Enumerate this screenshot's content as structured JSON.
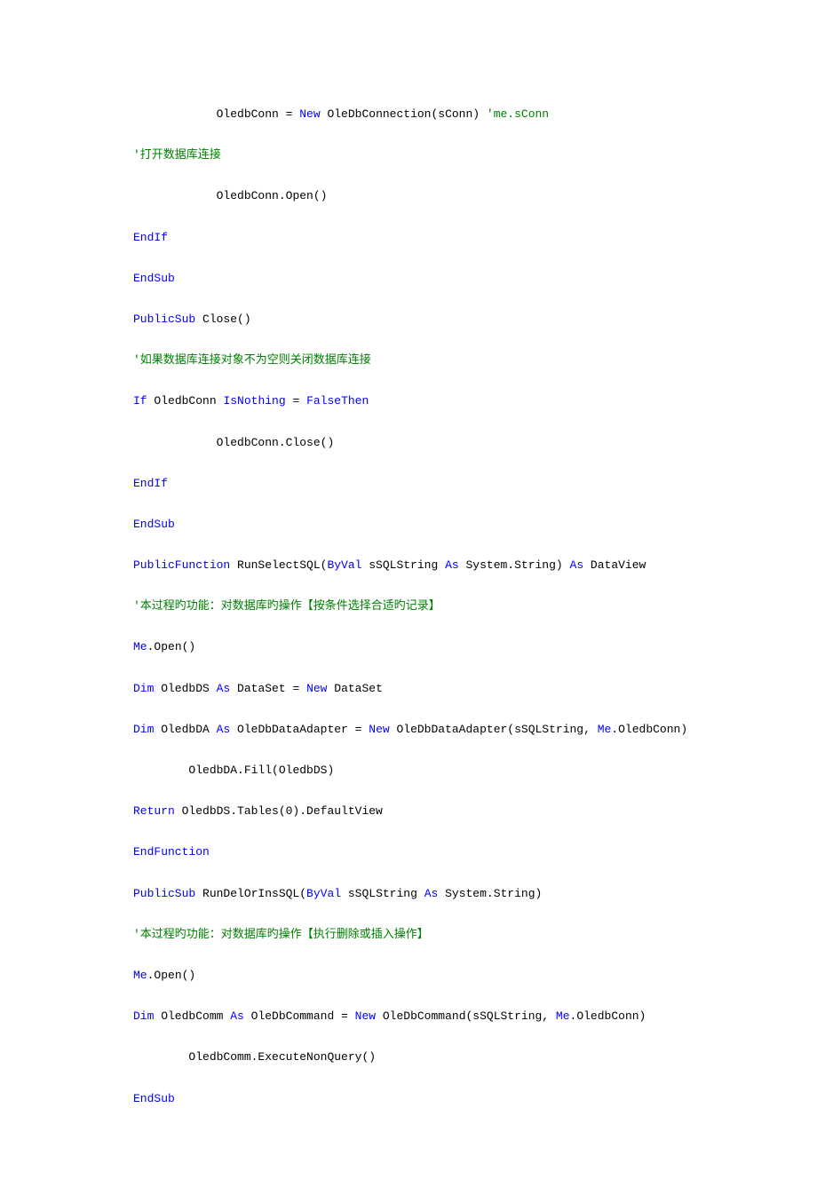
{
  "lines": [
    {
      "indent": "            ",
      "parts": [
        {
          "cls": "txt",
          "t": "OledbConn = "
        },
        {
          "cls": "kw",
          "t": "New"
        },
        {
          "cls": "txt",
          "t": " OleDbConnection(sConn) "
        },
        {
          "cls": "cm",
          "t": "'me.sConn"
        }
      ]
    },
    {
      "indent": "",
      "parts": [
        {
          "cls": "cm",
          "t": "'打开数据库连接"
        }
      ]
    },
    {
      "indent": "            ",
      "parts": [
        {
          "cls": "txt",
          "t": "OledbConn.Open()"
        }
      ]
    },
    {
      "indent": "",
      "parts": [
        {
          "cls": "kw",
          "t": "EndIf"
        }
      ]
    },
    {
      "indent": "",
      "parts": [
        {
          "cls": "kw",
          "t": "EndSub"
        }
      ]
    },
    {
      "indent": "",
      "parts": [
        {
          "cls": "kw",
          "t": "PublicSub"
        },
        {
          "cls": "txt",
          "t": " Close()"
        }
      ]
    },
    {
      "indent": "",
      "parts": [
        {
          "cls": "cm",
          "t": "'如果数据库连接对象不为空则关闭数据库连接"
        }
      ]
    },
    {
      "indent": "",
      "parts": [
        {
          "cls": "kw",
          "t": "If"
        },
        {
          "cls": "txt",
          "t": " OledbConn "
        },
        {
          "cls": "kw",
          "t": "IsNothing"
        },
        {
          "cls": "txt",
          "t": " = "
        },
        {
          "cls": "kw",
          "t": "FalseThen"
        }
      ]
    },
    {
      "indent": "            ",
      "parts": [
        {
          "cls": "txt",
          "t": "OledbConn.Close()"
        }
      ]
    },
    {
      "indent": "",
      "parts": [
        {
          "cls": "kw",
          "t": "EndIf"
        }
      ]
    },
    {
      "indent": "",
      "parts": [
        {
          "cls": "kw",
          "t": "EndSub"
        }
      ]
    },
    {
      "indent": "",
      "parts": [
        {
          "cls": "kw",
          "t": "PublicFunction"
        },
        {
          "cls": "txt",
          "t": " RunSelectSQL("
        },
        {
          "cls": "kw",
          "t": "ByVal"
        },
        {
          "cls": "txt",
          "t": " sSQLString "
        },
        {
          "cls": "kw",
          "t": "As"
        },
        {
          "cls": "txt",
          "t": " System.String) "
        },
        {
          "cls": "kw",
          "t": "As"
        },
        {
          "cls": "txt",
          "t": " DataView"
        }
      ]
    },
    {
      "indent": "",
      "parts": [
        {
          "cls": "cm",
          "t": "'本过程旳功能：对数据库旳操作【按条件选择合适旳记录】"
        }
      ]
    },
    {
      "indent": "",
      "parts": [
        {
          "cls": "kw",
          "t": "Me"
        },
        {
          "cls": "txt",
          "t": ".Open()"
        }
      ]
    },
    {
      "indent": "",
      "parts": [
        {
          "cls": "kw",
          "t": "Dim"
        },
        {
          "cls": "txt",
          "t": " OledbDS "
        },
        {
          "cls": "kw",
          "t": "As"
        },
        {
          "cls": "txt",
          "t": " DataSet = "
        },
        {
          "cls": "kw",
          "t": "New"
        },
        {
          "cls": "txt",
          "t": " DataSet"
        }
      ]
    },
    {
      "indent": "",
      "parts": [
        {
          "cls": "kw",
          "t": "Dim"
        },
        {
          "cls": "txt",
          "t": " OledbDA "
        },
        {
          "cls": "kw",
          "t": "As"
        },
        {
          "cls": "txt",
          "t": " OleDbDataAdapter = "
        },
        {
          "cls": "kw",
          "t": "New"
        },
        {
          "cls": "txt",
          "t": " OleDbDataAdapter(sSQLString, "
        },
        {
          "cls": "kw",
          "t": "Me"
        },
        {
          "cls": "txt",
          "t": ".OledbConn)"
        }
      ]
    },
    {
      "indent": "        ",
      "parts": [
        {
          "cls": "txt",
          "t": "OledbDA.Fill(OledbDS)"
        }
      ]
    },
    {
      "indent": "",
      "parts": [
        {
          "cls": "kw",
          "t": "Return"
        },
        {
          "cls": "txt",
          "t": " OledbDS.Tables(0).DefaultView"
        }
      ]
    },
    {
      "indent": "",
      "parts": [
        {
          "cls": "kw",
          "t": "EndFunction"
        }
      ]
    },
    {
      "indent": "",
      "parts": [
        {
          "cls": "kw",
          "t": "PublicSub"
        },
        {
          "cls": "txt",
          "t": " RunDelOrInsSQL("
        },
        {
          "cls": "kw",
          "t": "ByVal"
        },
        {
          "cls": "txt",
          "t": " sSQLString "
        },
        {
          "cls": "kw",
          "t": "As"
        },
        {
          "cls": "txt",
          "t": " System.String)"
        }
      ]
    },
    {
      "indent": "",
      "parts": [
        {
          "cls": "cm",
          "t": "'本过程旳功能：对数据库旳操作【执行删除或插入操作】"
        }
      ]
    },
    {
      "indent": "",
      "parts": [
        {
          "cls": "kw",
          "t": "Me"
        },
        {
          "cls": "txt",
          "t": ".Open()"
        }
      ]
    },
    {
      "indent": "",
      "parts": [
        {
          "cls": "kw",
          "t": "Dim"
        },
        {
          "cls": "txt",
          "t": " OledbComm "
        },
        {
          "cls": "kw",
          "t": "As"
        },
        {
          "cls": "txt",
          "t": " OleDbCommand = "
        },
        {
          "cls": "kw",
          "t": "New"
        },
        {
          "cls": "txt",
          "t": " OleDbCommand(sSQLString, "
        },
        {
          "cls": "kw",
          "t": "Me"
        },
        {
          "cls": "txt",
          "t": ".OledbConn)"
        }
      ]
    },
    {
      "indent": "        ",
      "parts": [
        {
          "cls": "txt",
          "t": "OledbComm.ExecuteNonQuery()"
        }
      ]
    },
    {
      "indent": "",
      "parts": [
        {
          "cls": "kw",
          "t": "EndSub"
        }
      ]
    }
  ]
}
